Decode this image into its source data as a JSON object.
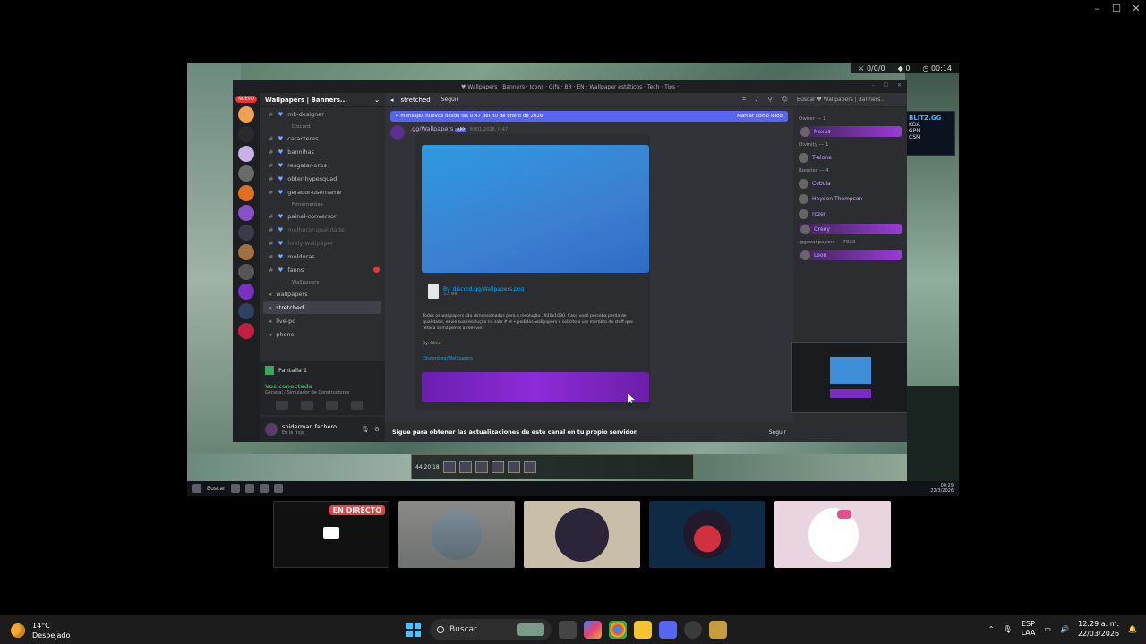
{
  "window": {
    "minimize": "–",
    "maximize": "☐",
    "close": "✕"
  },
  "game": {
    "hud_top": [
      "⚔ 0/0/0",
      "◆ 0",
      "◷ 00:14"
    ],
    "blitz": {
      "brand": "BLITZ.GG",
      "rows": [
        "KDA",
        "GPM",
        "CSM"
      ]
    },
    "stats": "44 20 18"
  },
  "discord": {
    "title": "♥ Wallpapers | Banners · Icons · Gifs · BR · EN · Wallpaper estáticos · Tech · Tips ·",
    "server_name": "Wallpapers | Banners...",
    "nuevo": "NUEVO",
    "channels": [
      {
        "name": "mk-designer",
        "muted": false
      },
      {
        "category": "Discord"
      },
      {
        "name": "caracteres",
        "muted": false
      },
      {
        "name": "bannihas",
        "muted": false
      },
      {
        "name": "resgatar-orbs",
        "muted": false
      },
      {
        "name": "obter-hypesquad",
        "muted": false
      },
      {
        "name": "gerador-username",
        "muted": false
      },
      {
        "category": "Ferramentas"
      },
      {
        "name": "painel-conversor",
        "muted": false
      },
      {
        "name": "melhorar-qualidade",
        "muted": true
      },
      {
        "name": "lively-wallpaper",
        "muted": true
      },
      {
        "name": "molduras",
        "muted": false
      },
      {
        "name": "fanns",
        "muted": false
      },
      {
        "category": "Wallpapers"
      },
      {
        "name": "wallpapers",
        "muted": false
      },
      {
        "name": "stretched",
        "muted": false,
        "active": true
      },
      {
        "name": "live-pc",
        "muted": false
      },
      {
        "name": "phone",
        "muted": false
      }
    ],
    "screen_share": "Pantalla 1",
    "voice": {
      "status": "Voz conectada",
      "sub": "General / Simulador de Constructores"
    },
    "user": {
      "name": "spiderman fachero",
      "status": "En la rioja"
    },
    "channel_header": {
      "name": "stretched",
      "follow": "Seguir"
    },
    "new_messages": {
      "text": "4 mensajes nuevos desde las 0:47 del 30 de enero de 2026",
      "action": "Marcar como leído"
    },
    "message": {
      "author": ".gg/Wallpapers",
      "app": "APP",
      "time": "30/01/2026, 0:47",
      "file_name": "By_discord.gg/Wallpapers.png",
      "file_size": "3.4 MB",
      "description": "Todos os wallpapers são dimensionados para a resolução 1920x1080. Caso você perceba perda de qualidade, envie sua resolução na sala # ✉ • pedidos-wallpapers e solicite a um membro da staff que refaça a imagem e a reenvie.",
      "by": "By: Oline",
      "link": "Discord.gg/Wallpapers"
    },
    "follow_bar": {
      "text": "Sigue para obtener las actualizaciones de este canal en tu propio servidor.",
      "button": "Seguir"
    },
    "search": "Buscar ♥ Wallpapers | Banners...",
    "members": [
      {
        "group": "Owner — 1"
      },
      {
        "name": "Noxus",
        "banner": true
      },
      {
        "group": "Divinity — 1"
      },
      {
        "name": "T-alone",
        "banner": false
      },
      {
        "group": "Booster — 4"
      },
      {
        "name": "Cebola",
        "banner": false
      },
      {
        "name": "Hayden Thompson",
        "banner": false
      },
      {
        "name": "rozer",
        "banner": false
      },
      {
        "name": "Greey",
        "banner": true
      },
      {
        "group": ".gg/wallpapers — 7923"
      },
      {
        "name": "Leon",
        "banner": true
      }
    ]
  },
  "inner_taskbar": {
    "search": "Buscar",
    "time": "00:29",
    "date": "22/3/2026"
  },
  "tiles": {
    "live": "EN DIRECTO"
  },
  "taskbar": {
    "temp": "14°C",
    "weather": "Despejado",
    "search": "Buscar",
    "lang1": "ESP",
    "lang2": "LAA",
    "time": "12:29 a. m.",
    "date": "22/03/2026"
  }
}
